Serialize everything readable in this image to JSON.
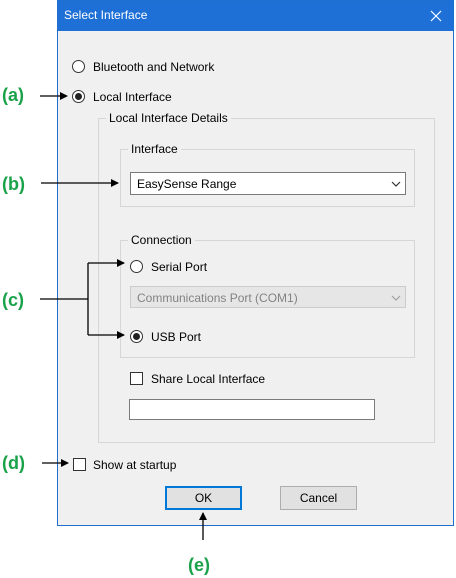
{
  "dialog": {
    "title": "Select Interface",
    "close_icon": "close-icon"
  },
  "options": {
    "bluetooth_label": "Bluetooth and Network",
    "local_label": "Local Interface",
    "selected": "Local Interface"
  },
  "local_details": {
    "legend": "Local Interface Details",
    "interface": {
      "legend": "Interface",
      "selected": "EasySense Range"
    },
    "connection": {
      "legend": "Connection",
      "serial_label": "Serial Port",
      "serial_port_selected": "Communications Port (COM1)",
      "usb_label": "USB Port",
      "selected": "USB Port"
    },
    "share_label": "Share Local Interface",
    "share_checked": false,
    "share_value": ""
  },
  "show_at_startup_label": "Show at startup",
  "show_at_startup_checked": false,
  "buttons": {
    "ok": "OK",
    "cancel": "Cancel"
  },
  "annotations": {
    "a": "(a)",
    "b": "(b)",
    "c": "(c)",
    "d": "(d)",
    "e": "(e)"
  },
  "colors": {
    "annotation": "#1aa24a",
    "titlebar": "#1e70d6",
    "default_button_border": "#0078d7"
  }
}
